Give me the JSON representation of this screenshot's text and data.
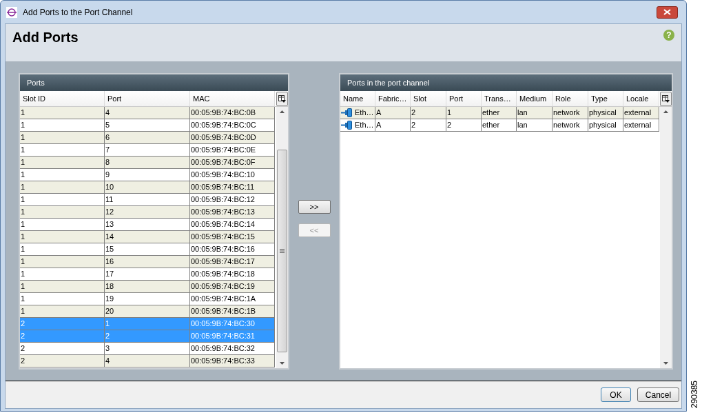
{
  "window": {
    "title": "Add Ports to the Port Channel"
  },
  "header": {
    "title": "Add Ports",
    "help": "?"
  },
  "ports_panel": {
    "title": "Ports",
    "columns": [
      "Slot ID",
      "Port",
      "MAC"
    ],
    "rows": [
      {
        "cells": [
          "1",
          "4",
          "00:05:9B:74:BC:0B"
        ],
        "selected": false
      },
      {
        "cells": [
          "1",
          "5",
          "00:05:9B:74:BC:0C"
        ],
        "selected": false
      },
      {
        "cells": [
          "1",
          "6",
          "00:05:9B:74:BC:0D"
        ],
        "selected": false
      },
      {
        "cells": [
          "1",
          "7",
          "00:05:9B:74:BC:0E"
        ],
        "selected": false
      },
      {
        "cells": [
          "1",
          "8",
          "00:05:9B:74:BC:0F"
        ],
        "selected": false
      },
      {
        "cells": [
          "1",
          "9",
          "00:05:9B:74:BC:10"
        ],
        "selected": false
      },
      {
        "cells": [
          "1",
          "10",
          "00:05:9B:74:BC:11"
        ],
        "selected": false
      },
      {
        "cells": [
          "1",
          "11",
          "00:05:9B:74:BC:12"
        ],
        "selected": false
      },
      {
        "cells": [
          "1",
          "12",
          "00:05:9B:74:BC:13"
        ],
        "selected": false
      },
      {
        "cells": [
          "1",
          "13",
          "00:05:9B:74:BC:14"
        ],
        "selected": false
      },
      {
        "cells": [
          "1",
          "14",
          "00:05:9B:74:BC:15"
        ],
        "selected": false
      },
      {
        "cells": [
          "1",
          "15",
          "00:05:9B:74:BC:16"
        ],
        "selected": false
      },
      {
        "cells": [
          "1",
          "16",
          "00:05:9B:74:BC:17"
        ],
        "selected": false
      },
      {
        "cells": [
          "1",
          "17",
          "00:05:9B:74:BC:18"
        ],
        "selected": false
      },
      {
        "cells": [
          "1",
          "18",
          "00:05:9B:74:BC:19"
        ],
        "selected": false
      },
      {
        "cells": [
          "1",
          "19",
          "00:05:9B:74:BC:1A"
        ],
        "selected": false
      },
      {
        "cells": [
          "1",
          "20",
          "00:05:9B:74:BC:1B"
        ],
        "selected": false
      },
      {
        "cells": [
          "2",
          "1",
          "00:05:9B:74:BC:30"
        ],
        "selected": true
      },
      {
        "cells": [
          "2",
          "2",
          "00:05:9B:74:BC:31"
        ],
        "selected": true
      },
      {
        "cells": [
          "2",
          "3",
          "00:05:9B:74:BC:32"
        ],
        "selected": false
      },
      {
        "cells": [
          "2",
          "4",
          "00:05:9B:74:BC:33"
        ],
        "selected": false
      }
    ]
  },
  "move_buttons": [
    {
      "label": ">>",
      "disabled": false
    },
    {
      "label": "<<",
      "disabled": true
    }
  ],
  "channel_panel": {
    "title": "Ports in the port channel",
    "columns": [
      "Name",
      "Fabric…",
      "Slot",
      "Port",
      "Trans…",
      "Medium",
      "Role",
      "Type",
      "Locale"
    ],
    "rows": [
      {
        "cells": [
          "Eth…",
          "A",
          "2",
          "1",
          "ether",
          "lan",
          "network",
          "physical",
          "external"
        ]
      },
      {
        "cells": [
          "Eth…",
          "A",
          "2",
          "2",
          "ether",
          "lan",
          "network",
          "physical",
          "external"
        ]
      }
    ]
  },
  "buttons": [
    "OK",
    "Cancel"
  ],
  "figure_number": "290385"
}
